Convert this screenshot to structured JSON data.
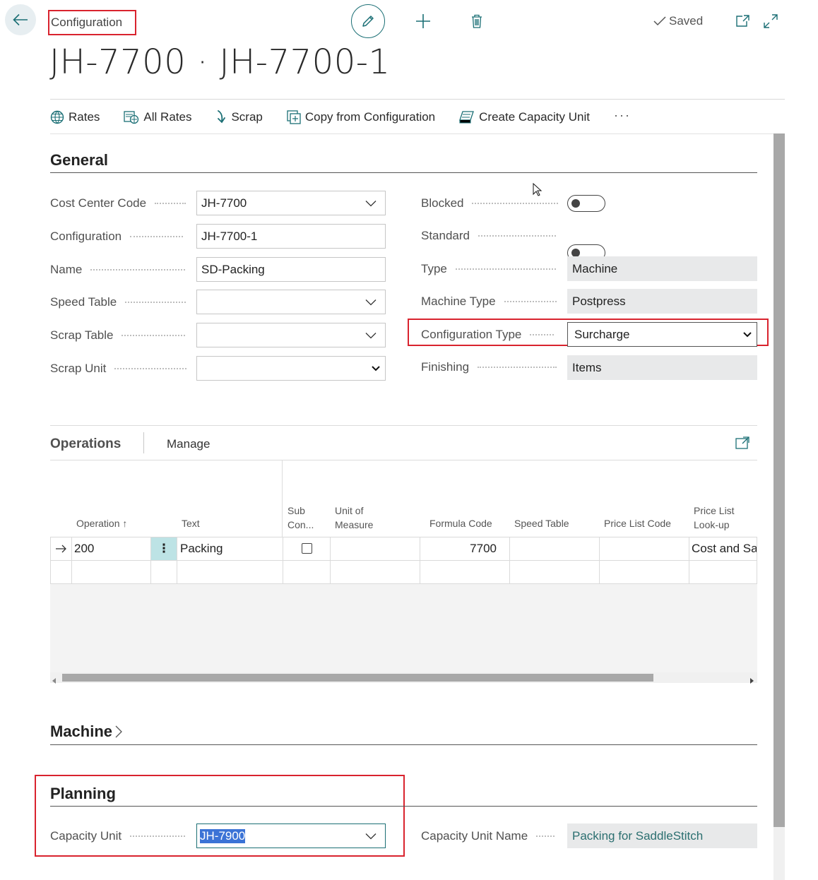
{
  "header": {
    "breadcrumb": "Configuration",
    "title": "JH-7700 · JH-7700-1",
    "saved_label": "Saved"
  },
  "actions": [
    {
      "label": "Rates",
      "icon": "globe-icon"
    },
    {
      "label": "All Rates",
      "icon": "all-rates-icon"
    },
    {
      "label": "Scrap",
      "icon": "scrap-arrow-icon"
    },
    {
      "label": "Copy from Configuration",
      "icon": "copy-icon"
    },
    {
      "label": "Create Capacity Unit",
      "icon": "capacity-unit-icon"
    }
  ],
  "more_label": "···",
  "general": {
    "title": "General",
    "left": [
      {
        "label": "Cost Center Code",
        "value": "JH-7700",
        "control": "lookup"
      },
      {
        "label": "Configuration",
        "value": "JH-7700-1",
        "control": "text"
      },
      {
        "label": "Name",
        "value": "SD-Packing",
        "control": "text"
      },
      {
        "label": "Speed Table",
        "value": "",
        "control": "lookup"
      },
      {
        "label": "Scrap Table",
        "value": "",
        "control": "lookup"
      },
      {
        "label": "Scrap Unit",
        "value": "",
        "control": "select"
      }
    ],
    "right": [
      {
        "label": "Blocked",
        "value": false,
        "control": "toggle"
      },
      {
        "label": "Standard",
        "value": false,
        "control": "toggle"
      },
      {
        "label": "Type",
        "value": "Machine",
        "control": "readonly"
      },
      {
        "label": "Machine Type",
        "value": "Postpress",
        "control": "readonly"
      },
      {
        "label": "Configuration Type",
        "value": "Surcharge",
        "control": "select"
      },
      {
        "label": "Finishing",
        "value": "Items",
        "control": "readonly"
      }
    ]
  },
  "operations": {
    "tab": "Operations",
    "manage": "Manage",
    "columns": {
      "operation": "Operation ↑",
      "text": "Text",
      "sub1": "Sub",
      "sub2": "Con...",
      "uom1": "Unit of",
      "uom2": "Measure",
      "formula": "Formula Code",
      "speed": "Speed Table",
      "price_code": "Price List Code",
      "lookup1": "Price List",
      "lookup2": "Look-up"
    },
    "row": {
      "operation": "200",
      "text": "Packing",
      "sub_con": false,
      "uom": "",
      "formula": "7700",
      "speed": "",
      "price_code": "",
      "lookup": "Cost and Sa"
    },
    "row_menu": "⋮"
  },
  "machine": {
    "title": "Machine"
  },
  "planning": {
    "title": "Planning",
    "capacity_unit_label": "Capacity Unit",
    "capacity_unit_value": "JH-7900",
    "capacity_unit_name_label": "Capacity Unit Name",
    "capacity_unit_name_value": "Packing for SaddleStitch"
  },
  "colors": {
    "accent": "#1b6f75",
    "highlight_box": "#d9232e",
    "readonly_bg": "#e8e9ea",
    "link_text": "#2b6f70"
  }
}
